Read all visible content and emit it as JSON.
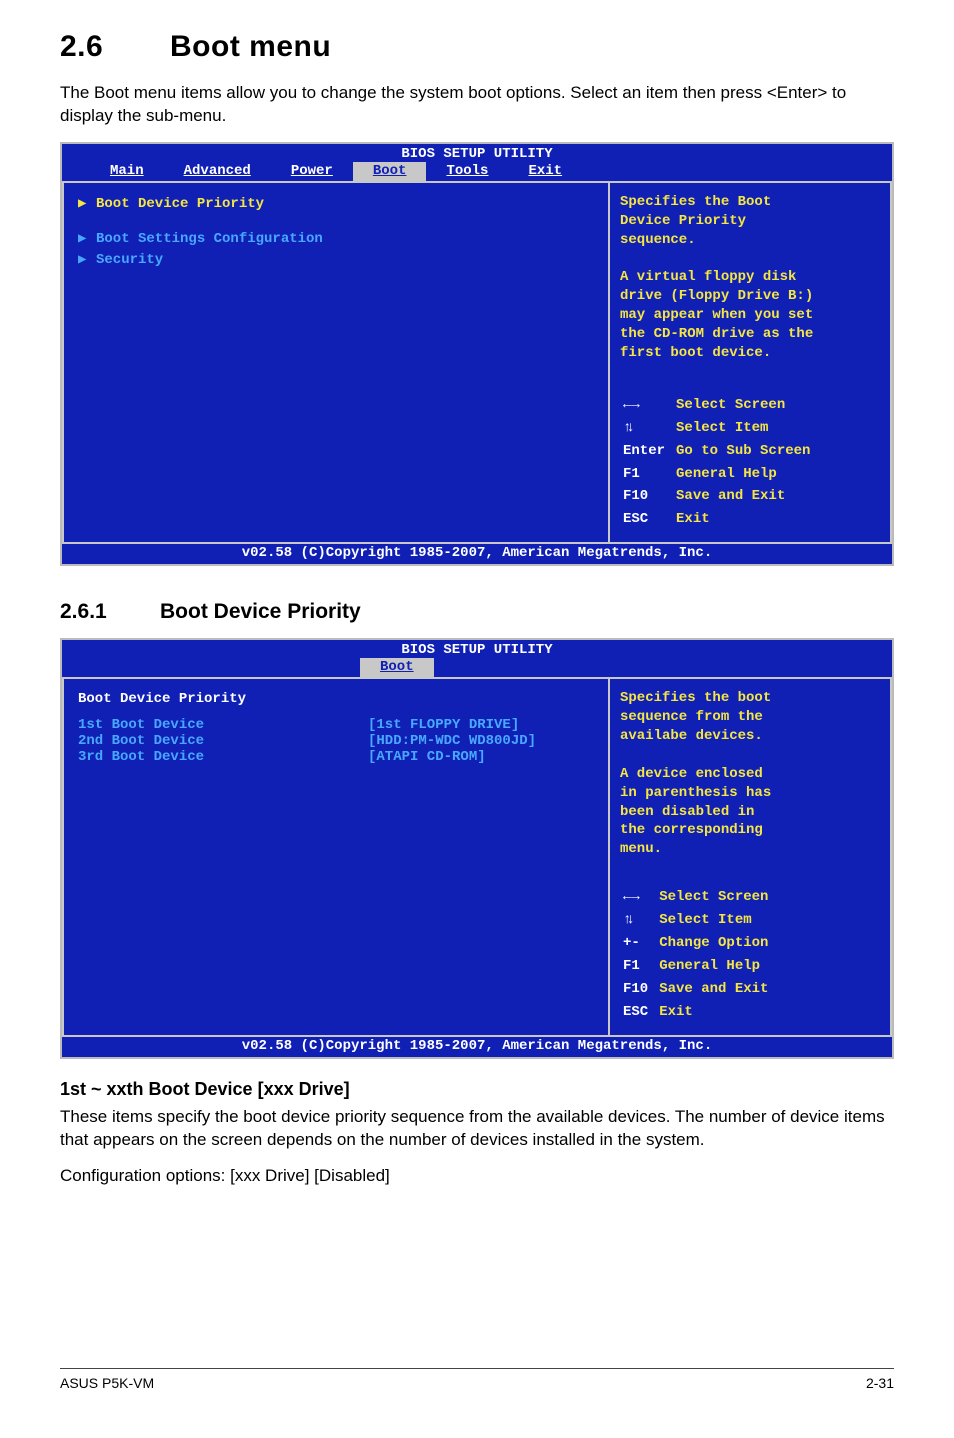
{
  "section": {
    "number": "2.6",
    "title": "Boot menu",
    "intro": "The Boot menu items allow you to change the system boot options. Select an item then press <Enter> to display the sub-menu."
  },
  "bios1": {
    "title": "BIOS SETUP UTILITY",
    "tabs": [
      "Main",
      "Advanced",
      "Power",
      "Boot",
      "Tools",
      "Exit"
    ],
    "active_tab": "Boot",
    "items": [
      "Boot Device Priority",
      "Boot Settings Configuration",
      "Security"
    ],
    "help_top": [
      "Specifies the Boot",
      "Device Priority",
      "sequence.",
      "",
      "A virtual floppy disk",
      "drive (Floppy Drive B:)",
      "may appear when you set",
      "the CD-ROM drive as the",
      "first boot device."
    ],
    "nav": {
      "arrows": "←→",
      "updown": "↑↓",
      "enter": "Enter",
      "f1": "F1",
      "f10": "F10",
      "esc": "ESC",
      "select_screen": "Select Screen",
      "select_item": "Select Item",
      "go_sub": "Go to Sub Screen",
      "general_help": "General Help",
      "save_exit": "Save and Exit",
      "exit": "Exit"
    },
    "copyright": "v02.58 (C)Copyright 1985-2007, American Megatrends, Inc."
  },
  "subsection": {
    "number": "2.6.1",
    "title": "Boot Device Priority"
  },
  "bios2": {
    "title": "BIOS SETUP UTILITY",
    "active_tab": "Boot",
    "header": "Boot Device Priority",
    "rows": [
      {
        "label": "1st Boot Device",
        "value": "[1st FLOPPY DRIVE]"
      },
      {
        "label": "2nd Boot Device",
        "value": "[HDD:PM-WDC WD800JD]"
      },
      {
        "label": "3rd Boot Device",
        "value": "[ATAPI CD-ROM]"
      }
    ],
    "help_top": [
      "Specifies the boot",
      "sequence from the",
      "availabe devices.",
      "",
      "A device enclosed",
      "in parenthesis has",
      "been disabled in",
      "the corresponding",
      "menu."
    ],
    "nav": {
      "arrows": "←→",
      "updown": "↑↓",
      "plusminus": "+-",
      "f1": "F1",
      "f10": "F10",
      "esc": "ESC",
      "select_screen": "Select Screen",
      "select_item": "Select Item",
      "change_option": "Change Option",
      "general_help": "General Help",
      "save_exit": "Save and Exit",
      "exit": "Exit"
    },
    "copyright": "v02.58 (C)Copyright 1985-2007, American Megatrends, Inc."
  },
  "paragraph2": {
    "title": "1st ~ xxth Boot Device [xxx Drive]",
    "p1": "These items specify the boot device priority sequence from the available devices. The number of device items that appears on the screen depends on the number of devices installed in the system.",
    "p2": "Configuration options: [xxx Drive] [Disabled]"
  },
  "footer": {
    "left": "ASUS P5K-VM",
    "right": "2-31"
  }
}
